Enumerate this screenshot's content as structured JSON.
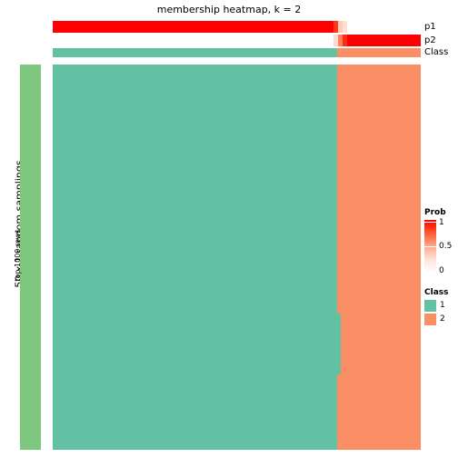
{
  "title": "membership heatmap, k = 2",
  "colors": {
    "class1": "#62c1a3",
    "class2": "#fa8f66",
    "row_split": "#7dc87e",
    "prob_high": "#ff0000",
    "prob_low": "#ffffff",
    "background": "#ffffff"
  },
  "row_axis": {
    "outer_label": "50 x 1 random samplings",
    "split_label": "top 1000 rows"
  },
  "annotations": [
    {
      "name": "p1",
      "label": "p1",
      "segments": [
        {
          "start_pct": 0.0,
          "end_pct": 76.3,
          "prob": 1.0,
          "color": "#ff0000"
        },
        {
          "start_pct": 76.3,
          "end_pct": 77.5,
          "prob": 0.82,
          "color": "#ff3a1c"
        },
        {
          "start_pct": 77.5,
          "end_pct": 78.8,
          "prob": 0.25,
          "color": "#ffcbbb"
        },
        {
          "start_pct": 78.8,
          "end_pct": 80.0,
          "prob": 0.12,
          "color": "#ffe0d5"
        },
        {
          "start_pct": 80.0,
          "end_pct": 100.0,
          "prob": 0.0,
          "color": "#ffffff"
        }
      ]
    },
    {
      "name": "p2",
      "label": "p2",
      "segments": [
        {
          "start_pct": 0.0,
          "end_pct": 76.3,
          "prob": 0.0,
          "color": "#ffffff"
        },
        {
          "start_pct": 76.3,
          "end_pct": 77.5,
          "prob": 0.18,
          "color": "#ffd9cc"
        },
        {
          "start_pct": 77.5,
          "end_pct": 78.8,
          "prob": 0.62,
          "color": "#ff7f5c"
        },
        {
          "start_pct": 78.8,
          "end_pct": 80.0,
          "prob": 0.88,
          "color": "#ff2a12"
        },
        {
          "start_pct": 80.0,
          "end_pct": 100.0,
          "prob": 1.0,
          "color": "#ff0000"
        }
      ]
    },
    {
      "name": "Class",
      "label": "Class",
      "segments": [
        {
          "start_pct": 0.0,
          "end_pct": 77.3,
          "class": "1",
          "color": "#62c1a3"
        },
        {
          "start_pct": 77.3,
          "end_pct": 100.0,
          "class": "2",
          "color": "#fa8f66"
        }
      ]
    }
  ],
  "heatmap": {
    "description": "consensus membership matrix, columns split into two classes",
    "blocks": [
      {
        "left_pct": 0.0,
        "top_pct": 0.0,
        "width_pct": 77.3,
        "height_pct": 64.6,
        "class": "1",
        "color": "#62c1a3"
      },
      {
        "left_pct": 0.0,
        "top_pct": 64.6,
        "width_pct": 78.3,
        "height_pct": 15.8,
        "class": "1",
        "color": "#62c1a3"
      },
      {
        "left_pct": 0.0,
        "top_pct": 80.4,
        "width_pct": 77.3,
        "height_pct": 19.6,
        "class": "1",
        "color": "#62c1a3"
      },
      {
        "left_pct": 77.3,
        "top_pct": 0.0,
        "width_pct": 22.7,
        "height_pct": 64.6,
        "class": "2",
        "color": "#fa8f66"
      },
      {
        "left_pct": 78.3,
        "top_pct": 64.6,
        "width_pct": 21.7,
        "height_pct": 15.8,
        "class": "2",
        "color": "#fa8f66"
      },
      {
        "left_pct": 77.3,
        "top_pct": 80.4,
        "width_pct": 22.7,
        "height_pct": 19.6,
        "class": "2",
        "color": "#fa8f66"
      }
    ]
  },
  "legends": {
    "prob": {
      "title": "Prob",
      "ticks": [
        "1",
        "0.5",
        "0"
      ],
      "max": 1,
      "mid": 0.5,
      "min": 0
    },
    "class": {
      "title": "Class",
      "entries": [
        {
          "label": "1",
          "color": "#62c1a3"
        },
        {
          "label": "2",
          "color": "#fa8f66"
        }
      ]
    }
  }
}
